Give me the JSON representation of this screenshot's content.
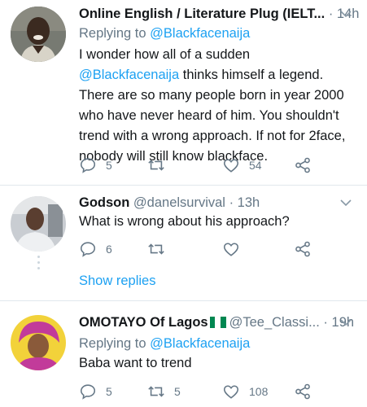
{
  "colors": {
    "accent": "#1da1f2",
    "muted": "#657786",
    "text": "#14171a",
    "divider": "#e1e8ed"
  },
  "tweets": [
    {
      "display_name": "Online English / Literature Plug (IELT...",
      "handle": "",
      "dot": "·",
      "time": "14h",
      "replying_label": "Replying to",
      "replying_handle": "@Blackfacenaija",
      "body_before": "I wonder how all of a sudden ",
      "body_mention": "@Blackfacenaija",
      "body_after": " thinks himself a legend. There are so many people born in year 2000 who have never heard of him. You shouldn't trend with a wrong approach. If not for 2face, nobody will still know blackface.",
      "replies": "5",
      "retweets": "",
      "likes": "54",
      "icons": [
        "reply-icon",
        "retweet-icon",
        "like-icon",
        "share-icon"
      ]
    },
    {
      "display_name": "Godson",
      "handle": "@danelsurvival",
      "dot": "·",
      "time": "13h",
      "body": "What is wrong about his approach?",
      "replies": "6",
      "retweets": "",
      "likes": "",
      "show_replies": "Show replies"
    },
    {
      "display_name": "OMOTAYO Of Lagos",
      "flag": "nigeria-flag-icon",
      "handle": "@Tee_Classi...",
      "dot": "·",
      "time": "19h",
      "replying_label": "Replying to",
      "replying_handle": "@Blackfacenaija",
      "body": "Baba want to trend",
      "replies": "5",
      "retweets": "5",
      "likes": "108"
    }
  ]
}
